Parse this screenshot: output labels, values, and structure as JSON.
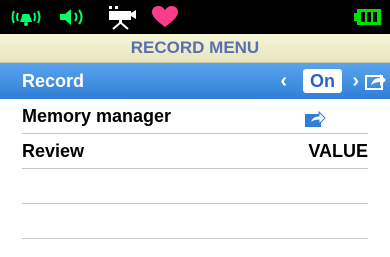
{
  "status_bar": {
    "icons": [
      "notification-sound-icon",
      "speaker-icon",
      "camera-icon",
      "heart-icon",
      "battery-icon"
    ],
    "colors": {
      "accent": "#00ff66",
      "heart": "#ff3c8c",
      "battery": "#00e000"
    }
  },
  "menu": {
    "title": "RECORD MENU",
    "items": [
      {
        "label": "Record",
        "value": "On",
        "selected": true
      },
      {
        "label": "Memory manager",
        "value_icon": "share-icon"
      },
      {
        "label": "Review",
        "value": "VALUE"
      }
    ]
  },
  "colors": {
    "selection": "#3c8ee2",
    "title_text": "#5a6fb0"
  }
}
